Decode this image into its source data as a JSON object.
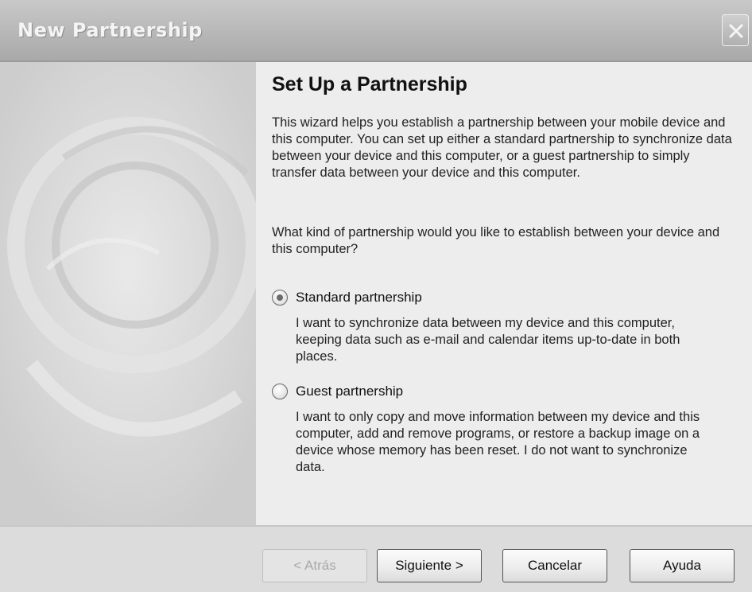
{
  "window": {
    "title": "New Partnership"
  },
  "wizard": {
    "heading": "Set Up a Partnership",
    "intro": "This wizard helps you establish a partnership between your mobile device and this computer.  You can set up either a standard partnership to synchronize data between your device and this computer, or a guest partnership to simply transfer data between your device and this computer.",
    "question": "What kind of partnership would you like to establish between your device and this computer?",
    "options": [
      {
        "label": "Standard partnership",
        "selected": true,
        "description": "I want to synchronize data between my device and this computer, keeping data such as e-mail and calendar items up-to-date in both places."
      },
      {
        "label": "Guest partnership",
        "selected": false,
        "description": "I want to only copy and move information between my device and this computer, add and remove programs, or restore a backup image on a device whose memory has been reset. I do not want to synchronize data."
      }
    ]
  },
  "buttons": {
    "back": "< Atrás",
    "next": "Siguiente >",
    "cancel": "Cancelar",
    "help": "Ayuda"
  },
  "icons": {
    "close": "close-icon",
    "decoration": "swirl-graphic"
  }
}
